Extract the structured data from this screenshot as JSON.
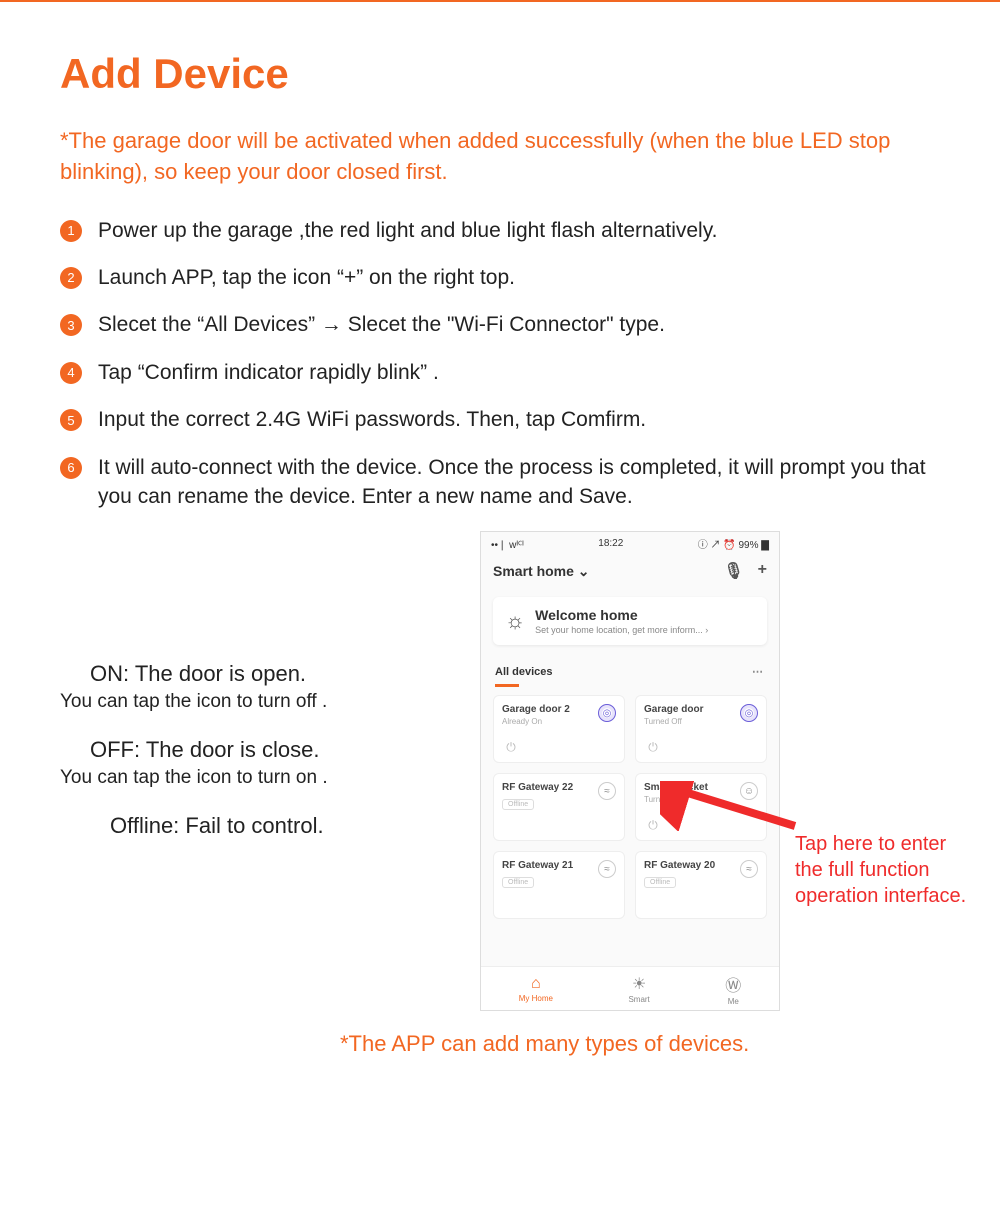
{
  "title": "Add Device",
  "warning": "*The garage door will be activated when added successfully (when the blue LED stop blinking), so keep your door closed first.",
  "steps": [
    "Power up the garage ,the red light and blue light flash alternatively.",
    "Launch APP, tap the icon “+” on the right top.",
    "Slecet the “All Devices” → Slecet the \"Wi-Fi Connector\" type.",
    "Tap “Confirm indicator rapidly blink” .",
    "Input the correct 2.4G WiFi passwords. Then, tap Comfirm.",
    "It will auto-connect with the device. Once the process is completed, it will prompt you that you can rename the device. Enter a new name and Save."
  ],
  "status_info": {
    "on_head": "ON: The door is open.",
    "on_sub": "You can tap the icon to turn off .",
    "off_head": "OFF: The door is close.",
    "off_sub": "You can tap the icon to turn on .",
    "offline": "Offline: Fail to control."
  },
  "phone": {
    "status_left": "••❘ ᴡᴵꟲᴵ",
    "time": "18:22",
    "status_right": "ⓘ ↗ ⏰ 99% ▇",
    "app_title": "Smart home ⌄",
    "welcome_title": "Welcome home",
    "welcome_sub": "Set your home location, get more inform...  ›",
    "section": "All devices",
    "cards": [
      {
        "name": "Garage door 2",
        "status": "Already On",
        "icon_type": "purple",
        "power": true
      },
      {
        "name": "Garage door",
        "status": "Turned Off",
        "icon_type": "purple",
        "power": true
      },
      {
        "name": "RF Gateway 22",
        "status": "",
        "icon_type": "wifi",
        "badge": "Offline"
      },
      {
        "name": "Smart Socket",
        "status": "Turned Off",
        "icon_type": "face",
        "power": true
      },
      {
        "name": "RF Gateway 21",
        "status": "",
        "icon_type": "wifi",
        "badge": "Offline"
      },
      {
        "name": "RF Gateway 20",
        "status": "",
        "icon_type": "wifi",
        "badge": "Offline"
      }
    ],
    "nav": [
      {
        "icon": "⌂",
        "label": "My Home",
        "active": true
      },
      {
        "icon": "☀",
        "label": "Smart",
        "active": false
      },
      {
        "icon": "Ⓦ",
        "label": "Me",
        "active": false
      }
    ]
  },
  "callout": "Tap here to enter the full function operation interface.",
  "footnote": "*The APP can add many types of devices."
}
